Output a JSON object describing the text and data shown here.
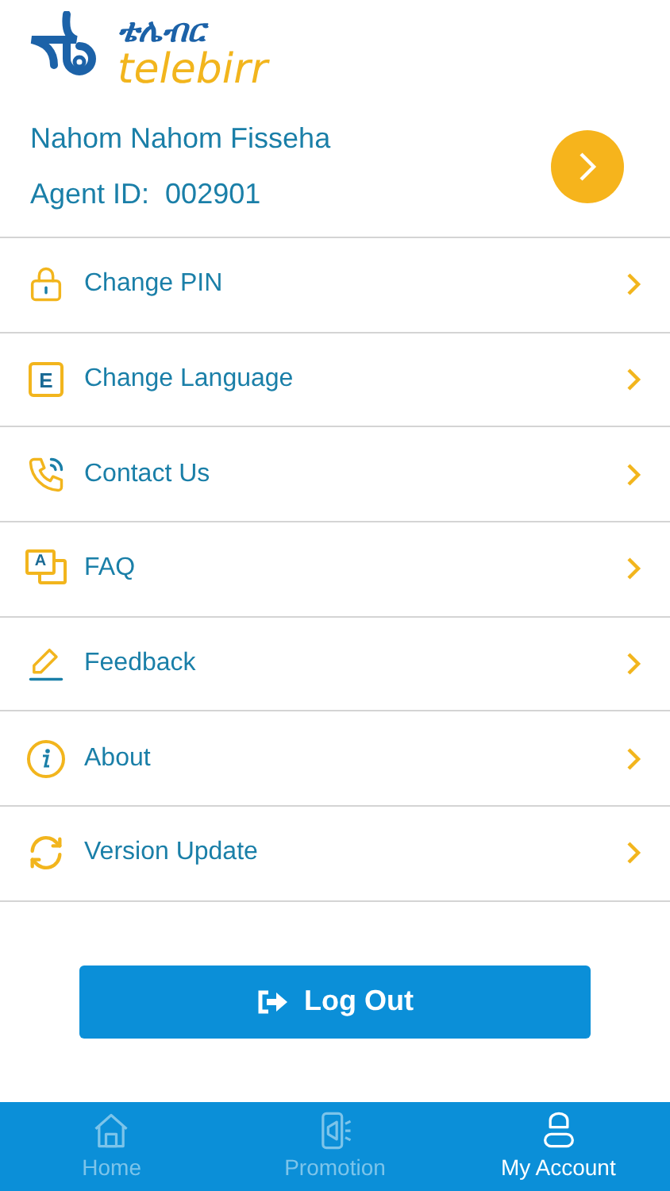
{
  "logo": {
    "amharic": "ቴሌብር",
    "latin": "telebirr"
  },
  "profile": {
    "name": "Nahom Nahom Fisseha",
    "agent_label": "Agent ID:",
    "agent_id": "002901"
  },
  "menu": [
    {
      "kind": "lock",
      "label": "Change PIN"
    },
    {
      "kind": "language",
      "label": "Change Language",
      "icon_letter": "E"
    },
    {
      "kind": "phone",
      "label": "Contact Us"
    },
    {
      "kind": "faq",
      "label": "FAQ",
      "icon_letter": "A"
    },
    {
      "kind": "pencil",
      "label": "Feedback"
    },
    {
      "kind": "info",
      "label": "About"
    },
    {
      "kind": "refresh",
      "label": "Version Update"
    }
  ],
  "logout_button": "Log Out",
  "bottom_nav": [
    {
      "kind": "home",
      "label": "Home",
      "selected": false
    },
    {
      "kind": "promotion",
      "label": "Promotion",
      "selected": false
    },
    {
      "kind": "account",
      "label": "My Account",
      "selected": true
    }
  ]
}
